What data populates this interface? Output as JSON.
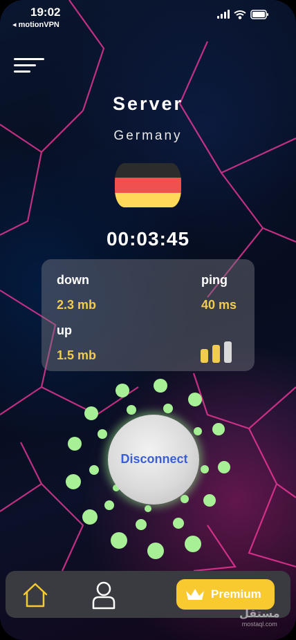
{
  "status_bar": {
    "time": "19:02",
    "back_label": "◂ motionVPN"
  },
  "header": {
    "title": "Server",
    "country": "Germany"
  },
  "flag": {
    "colors": [
      "#2c2c2c",
      "#f05050",
      "#ffd95a"
    ]
  },
  "connection": {
    "timer": "00:03:45"
  },
  "stats": {
    "down_label": "down",
    "down_value": "2.3 mb",
    "up_label": "up",
    "up_value": "1.5 mb",
    "ping_label": "ping",
    "ping_value": "40 ms",
    "signal_strength": "2/3"
  },
  "action": {
    "button_label": "Disconnect"
  },
  "nav": {
    "premium_label": "Premium"
  },
  "watermark": {
    "text": "مستقل",
    "domain": "mostaql.com"
  },
  "colors": {
    "accent": "#f9c930",
    "dots": "#a8f096",
    "value": "#f2cc4d",
    "button_text": "#3b5fd0"
  }
}
